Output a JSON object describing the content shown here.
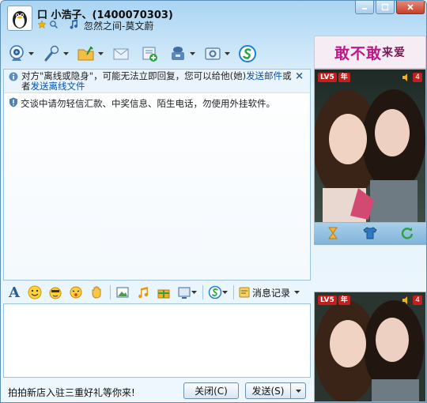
{
  "title": {
    "name": "口  小浩子、(1400070303)",
    "music": "忽然之间-莫文蔚"
  },
  "toolbar": {
    "items": [
      {
        "name": "video-call-icon",
        "has_arrow": true
      },
      {
        "name": "voice-call-icon",
        "has_arrow": true
      },
      {
        "name": "send-file-icon",
        "has_arrow": true
      },
      {
        "name": "send-email-icon",
        "has_arrow": false
      },
      {
        "name": "create-group-icon",
        "has_arrow": false
      },
      {
        "name": "apps-icon",
        "has_arrow": true
      },
      {
        "name": "settings-icon",
        "has_arrow": true
      },
      {
        "name": "soso-icon",
        "has_arrow": false
      }
    ]
  },
  "notice": {
    "text_before": "对方\"离线或隐身\"，可能无法立即回复，您可以给他(她)",
    "link1": "发送邮件",
    "middle": "或者",
    "link2": "发送离线文件",
    "close": "×"
  },
  "warning": "交谈中请勿轻信汇款、中奖信息、陌生电话，勿使用外挂软件。",
  "format_bar": {
    "font_glyph": "A",
    "history_label": "消息记录"
  },
  "bottom": {
    "ad_text": "拍拍新店入驻三重好礼等你来!",
    "close_label": "关闭(C)",
    "send_label": "发送(S)"
  },
  "show": {
    "banner_big": "敢不敢",
    "banner_small": "来爱",
    "level": "LV5",
    "year": "年",
    "volume": "4"
  },
  "colors": {
    "title_gradient_top": "#a9d4f2",
    "link": "#0a55b2",
    "close_button": "#c2412a",
    "badge_red": "#c21f1f",
    "banner_text": "#c0178a"
  }
}
